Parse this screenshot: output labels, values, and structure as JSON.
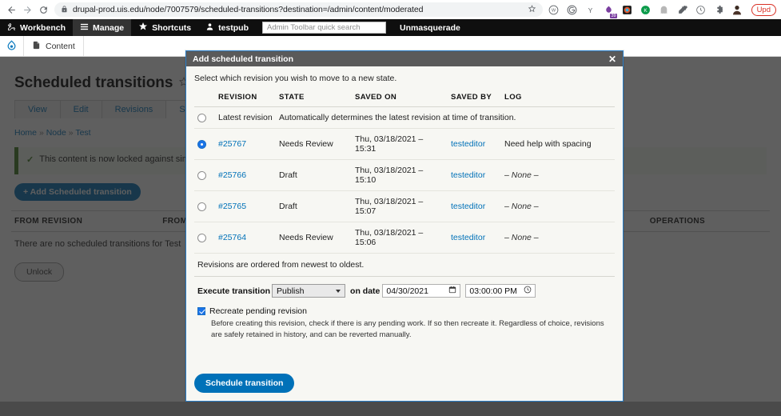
{
  "browser": {
    "back_icon": "back-arrow-icon",
    "forward_icon": "forward-arrow-icon",
    "reload_icon": "reload-icon",
    "lock_icon": "lock-icon",
    "url": "drupal-prod.uis.edu/node/7007579/scheduled-transitions?destination=/admin/content/moderated",
    "star_icon": "bookmark-star-icon",
    "extensions": [
      {
        "name": "wordpress-extension-icon",
        "glyph": "ⓜ",
        "color": "#5f6368"
      },
      {
        "name": "grammarly-extension-icon",
        "glyph": "◔",
        "color": "#5f6368"
      },
      {
        "name": "yandex-extension-icon",
        "glyph": "Y",
        "color": "#5f6368"
      },
      {
        "name": "sitebulb-extension-icon",
        "glyph": "♣",
        "color": "#7b3fa0"
      },
      {
        "name": "colorzilla-extension-icon",
        "glyph": "◉",
        "color": "#e8562a"
      },
      {
        "name": "kaspersky-extension-icon",
        "glyph": "K",
        "color": "#0a9b4a"
      },
      {
        "name": "ghostery-extension-icon",
        "glyph": "●",
        "color": "#b7b7b7"
      },
      {
        "name": "eyedropper-extension-icon",
        "glyph": "✐",
        "color": "#5f6368"
      },
      {
        "name": "clock-extension-icon",
        "glyph": "◑",
        "color": "#5f6368"
      },
      {
        "name": "puzzle-extensions-icon",
        "glyph": "❖",
        "color": "#5f6368"
      }
    ],
    "badge_count": "39",
    "avatar": "user-avatar",
    "update_label": "Upd"
  },
  "admin_toolbar": {
    "items": [
      {
        "label": "Workbench",
        "icon": "workbench-icon",
        "active": false
      },
      {
        "label": "Manage",
        "icon": "hamburger-icon",
        "active": true
      },
      {
        "label": "Shortcuts",
        "icon": "star-icon",
        "active": false
      },
      {
        "label": "testpub",
        "icon": "user-icon",
        "active": false
      }
    ],
    "search_placeholder": "Admin Toolbar quick search",
    "unmasquerade_label": "Unmasquerade"
  },
  "sub_toolbar": {
    "logo": "drupal-logo",
    "content_label": "Content",
    "content_icon": "document-icon"
  },
  "page": {
    "title": "Scheduled transitions",
    "favorite_icon": "star-outline-icon",
    "tabs": [
      {
        "label": "View",
        "active": false
      },
      {
        "label": "Edit",
        "active": false
      },
      {
        "label": "Revisions",
        "active": false
      },
      {
        "label": "Scheduled transitions",
        "active": true
      }
    ],
    "breadcrumb": [
      "Home",
      "Node",
      "Test"
    ],
    "status_message": "This content is now locked against simultaneous",
    "add_button": "+ Add Scheduled transition",
    "table_headers": [
      "FROM REVISION",
      "FROM STATE",
      "OPERATIONS"
    ],
    "empty_message": "There are no scheduled transitions for Test",
    "unlock_button": "Unlock"
  },
  "modal": {
    "title": "Add scheduled transition",
    "close_icon": "close-icon",
    "intro": "Select which revision you wish to move to a new state.",
    "table": {
      "headers": [
        "REVISION",
        "STATE",
        "SAVED ON",
        "SAVED BY",
        "LOG"
      ],
      "rows": [
        {
          "selected": false,
          "revision": "Latest revision",
          "is_link": false,
          "description": "Automatically determines the latest revision at time of transition.",
          "spans_all": true
        },
        {
          "selected": true,
          "revision": "#25767",
          "is_link": true,
          "state": "Needs Review",
          "saved_on": "Thu, 03/18/2021 – 15:31",
          "saved_by": "testeditor",
          "log": "Need help with spacing",
          "log_none": false
        },
        {
          "selected": false,
          "revision": "#25766",
          "is_link": true,
          "state": "Draft",
          "saved_on": "Thu, 03/18/2021 – 15:10",
          "saved_by": "testeditor",
          "log": "None",
          "log_none": true
        },
        {
          "selected": false,
          "revision": "#25765",
          "is_link": true,
          "state": "Draft",
          "saved_on": "Thu, 03/18/2021 – 15:07",
          "saved_by": "testeditor",
          "log": "None",
          "log_none": true
        },
        {
          "selected": false,
          "revision": "#25764",
          "is_link": true,
          "state": "Needs Review",
          "saved_on": "Thu, 03/18/2021 – 15:06",
          "saved_by": "testeditor",
          "log": "None",
          "log_none": true
        }
      ],
      "note": "Revisions are ordered from newest to oldest."
    },
    "execute": {
      "label": "Execute transition",
      "transition_value": "Publish",
      "transition_options": [
        "Publish"
      ],
      "on_date_label": "on date",
      "date_value": "04/30/2021",
      "date_icon": "calendar-icon",
      "time_value": "03:00:00 PM",
      "time_icon": "clock-icon"
    },
    "recreate": {
      "checked": true,
      "label": "Recreate pending revision",
      "description": "Before creating this revision, check if there is any pending work. If so then recreate it. Regardless of choice, revisions are safely retained in history, and can be reverted manually."
    },
    "submit_label": "Schedule transition"
  },
  "colors": {
    "accent_blue": "#0071b8",
    "radio_blue": "#1a73e8",
    "modal_border": "#2a7fc9",
    "modal_header_bg": "#5a5a5a",
    "toolbar_black": "#0f0f0f",
    "status_green": "#3d7a1f"
  }
}
